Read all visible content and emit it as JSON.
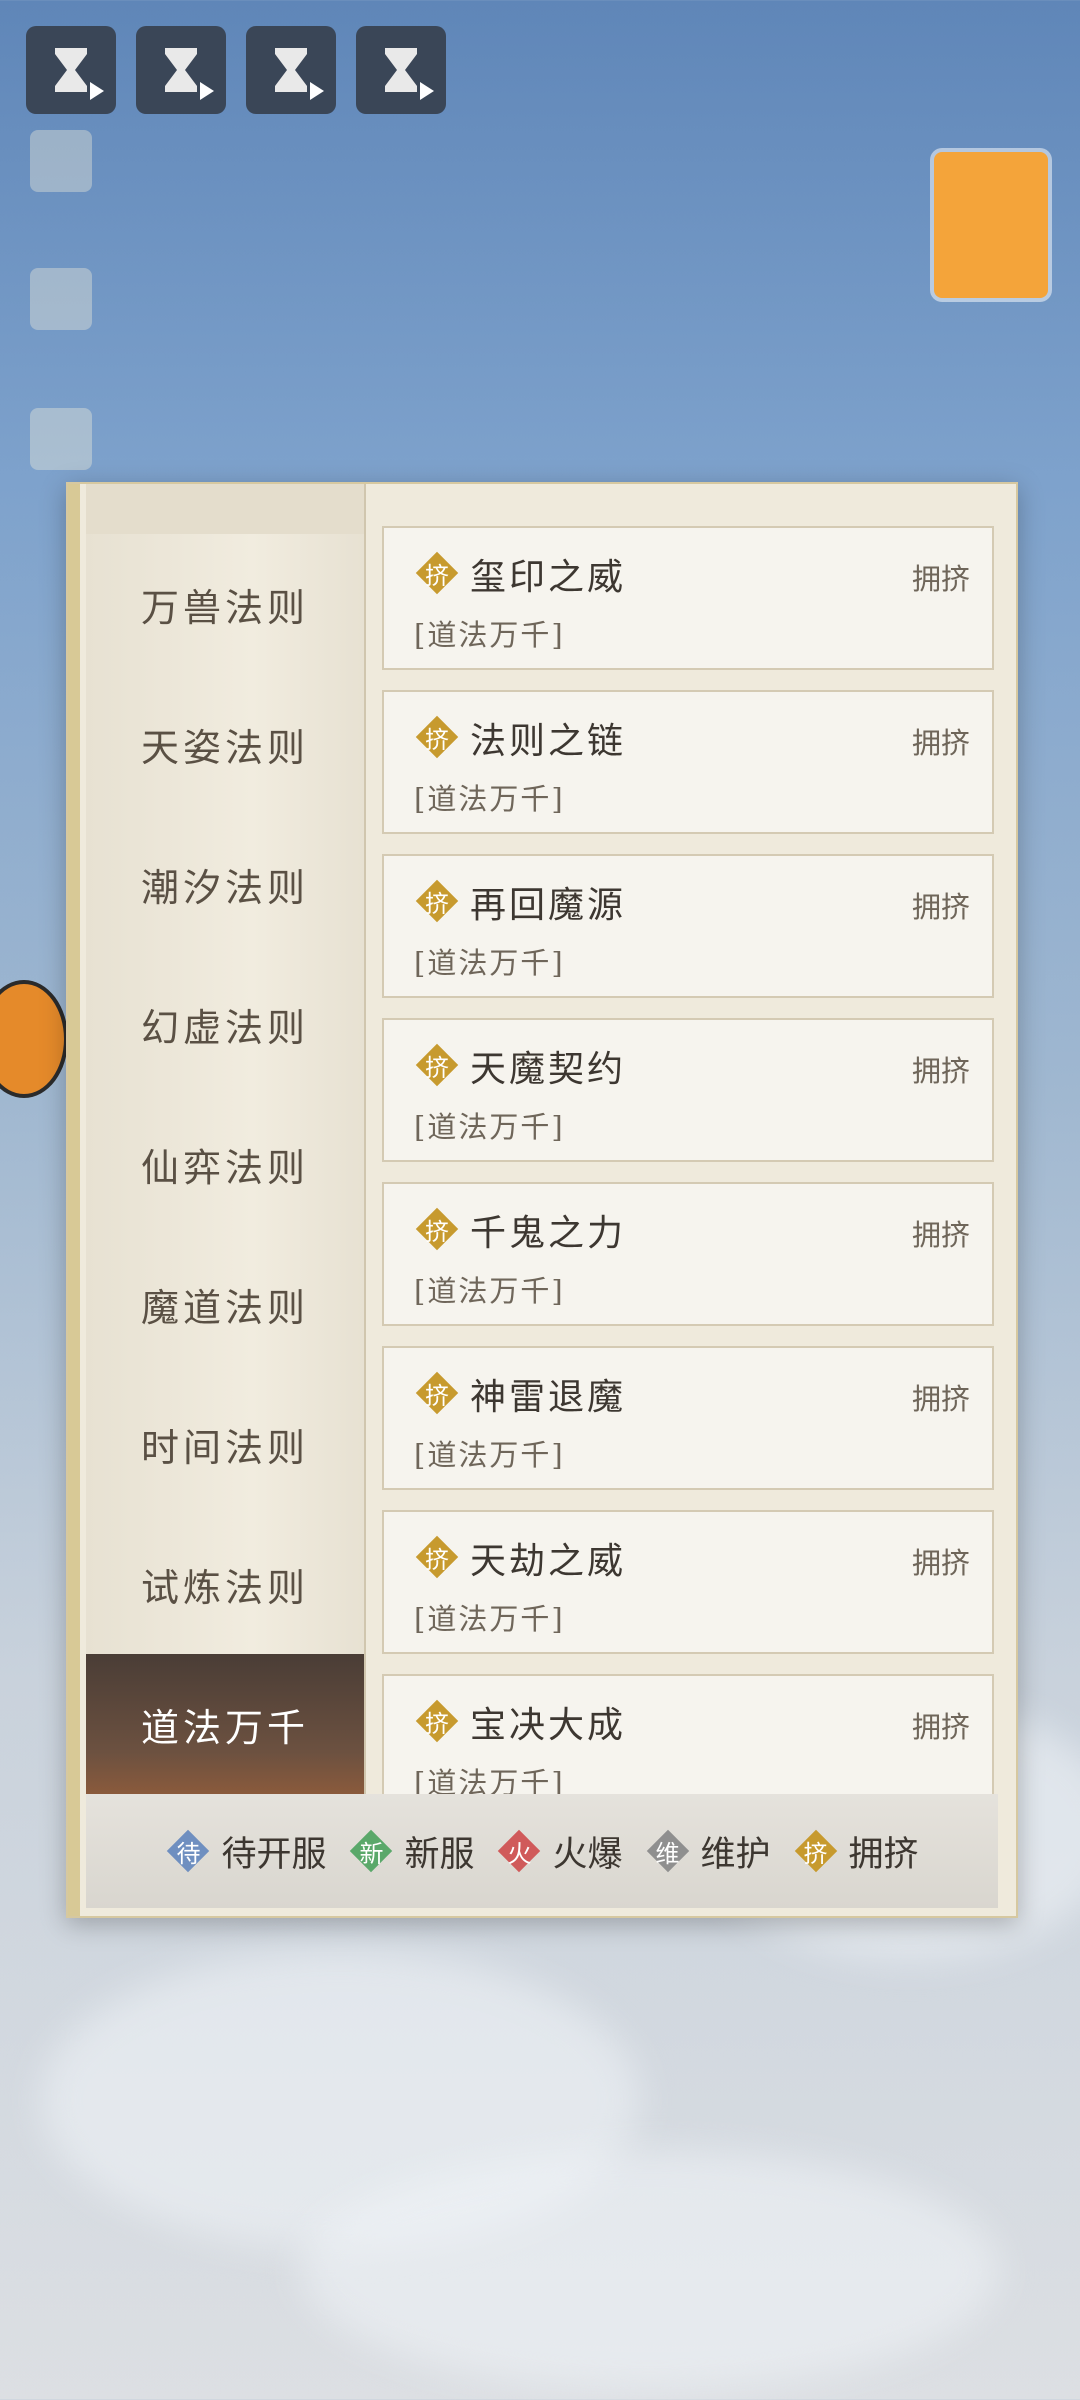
{
  "categories": [
    {
      "label": "万兽法则"
    },
    {
      "label": "天姿法则"
    },
    {
      "label": "潮汐法则"
    },
    {
      "label": "幻虚法则"
    },
    {
      "label": "仙弈法则"
    },
    {
      "label": "魔道法则"
    },
    {
      "label": "时间法则"
    },
    {
      "label": "试炼法则"
    },
    {
      "label": "道法万千",
      "active": true
    }
  ],
  "servers": [
    {
      "name": "玺印之威",
      "status": "拥挤",
      "badge": "挤",
      "server": "[道法万千]"
    },
    {
      "name": "法则之链",
      "status": "拥挤",
      "badge": "挤",
      "server": "[道法万千]"
    },
    {
      "name": "再回魔源",
      "status": "拥挤",
      "badge": "挤",
      "server": "[道法万千]"
    },
    {
      "name": "天魔契约",
      "status": "拥挤",
      "badge": "挤",
      "server": "[道法万千]"
    },
    {
      "name": "千鬼之力",
      "status": "拥挤",
      "badge": "挤",
      "server": "[道法万千]"
    },
    {
      "name": "神雷退魔",
      "status": "拥挤",
      "badge": "挤",
      "server": "[道法万千]"
    },
    {
      "name": "天劫之威",
      "status": "拥挤",
      "badge": "挤",
      "server": "[道法万千]"
    },
    {
      "name": "宝决大成",
      "status": "拥挤",
      "badge": "挤",
      "server": "[道法万千]"
    }
  ],
  "legend": [
    {
      "badge": "待",
      "label": "待开服",
      "color": "#6f8fc0"
    },
    {
      "badge": "新",
      "label": "新服",
      "color": "#5aa86a"
    },
    {
      "badge": "火",
      "label": "火爆",
      "color": "#d05a5a"
    },
    {
      "badge": "维",
      "label": "维护",
      "color": "#8f8f8f"
    },
    {
      "badge": "挤",
      "label": "拥挤",
      "color": "#c79a2e"
    }
  ],
  "colors": {
    "crowded": "#c79a2e",
    "panel": "#efeadc",
    "active_tab": "#5a4438"
  },
  "top_buttons": [
    {
      "icon": "hourglass-play-icon"
    },
    {
      "icon": "hourglass-play-icon"
    },
    {
      "icon": "hourglass-play-icon"
    },
    {
      "icon": "hourglass-play-icon"
    }
  ]
}
